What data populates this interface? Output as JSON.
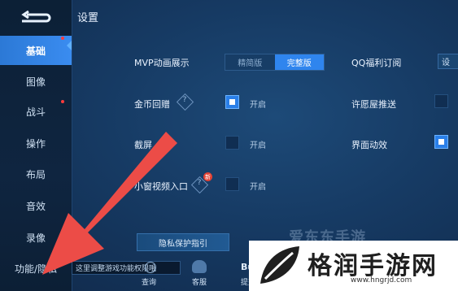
{
  "header": {
    "title": "设置"
  },
  "sidebar": {
    "items": [
      {
        "label": "基础",
        "active": true,
        "dot": true
      },
      {
        "label": "图像",
        "active": false,
        "dot": false
      },
      {
        "label": "战斗",
        "active": false,
        "dot": true
      },
      {
        "label": "操作",
        "active": false,
        "dot": false
      },
      {
        "label": "布局",
        "active": false,
        "dot": false
      },
      {
        "label": "音效",
        "active": false,
        "dot": false
      },
      {
        "label": "录像",
        "active": false,
        "dot": false
      },
      {
        "label": "功能/隐私",
        "active": false,
        "dot": false
      }
    ]
  },
  "settings": {
    "mvp": {
      "label": "MVP动画展示",
      "options": [
        "精简版",
        "完整版"
      ],
      "selected": "完整版"
    },
    "coin": {
      "label": "金币回赠",
      "help": "?",
      "checked": true,
      "state": "开启"
    },
    "screenshot": {
      "label": "截屏",
      "checked": false,
      "state": "开启"
    },
    "mini_video": {
      "label": "小窗视频入口",
      "badge": "新",
      "help": "?",
      "checked": false,
      "state": "开启"
    },
    "qq": {
      "label": "QQ福利订阅",
      "button": "设"
    },
    "wish": {
      "label": "许愿屋推送",
      "checked": false
    },
    "ui_anim": {
      "label": "界面动效",
      "checked": true
    }
  },
  "privacy_button": "隐私保护指引",
  "tooltip": "这里调整游戏功能权限哦",
  "bottom_bar": {
    "query": "查询",
    "service": "客服",
    "submit": "提交"
  },
  "watermarks": {
    "faint": "爱东东手游",
    "logo": "格润手游网",
    "url": "www.hngrjd.com"
  },
  "colors": {
    "accent": "#2f85ee",
    "background": "#163a63",
    "arrow": "#ec4c47"
  }
}
